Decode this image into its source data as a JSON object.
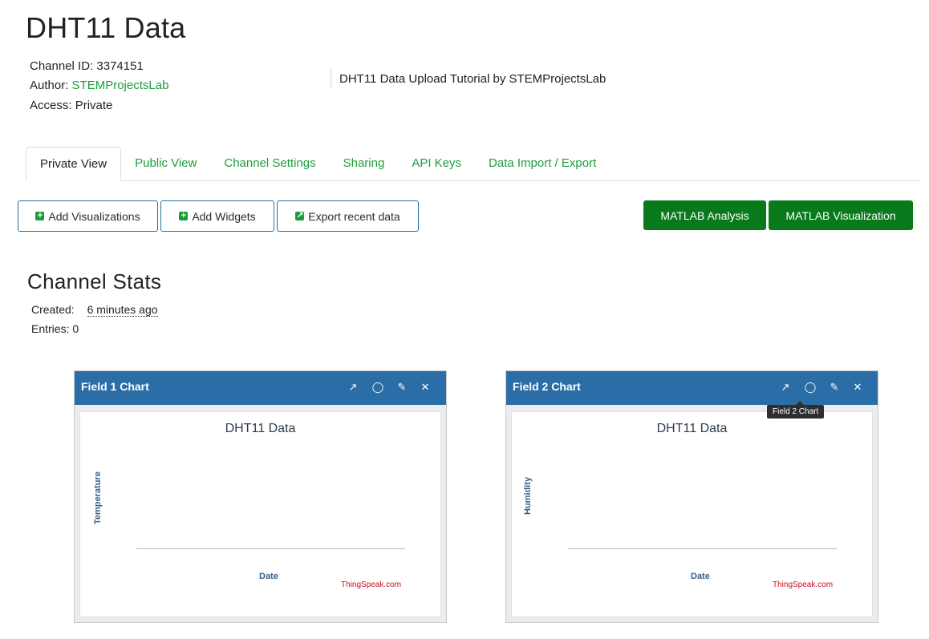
{
  "channel": {
    "title": "DHT11 Data",
    "id_label": "Channel ID:",
    "id_value": "3374151",
    "author_label": "Author:",
    "author_value": "STEMProjectsLab",
    "access_label": "Access:",
    "access_value": "Private",
    "description": "DHT11 Data Upload Tutorial by STEMProjectsLab"
  },
  "tabs": [
    {
      "label": "Private View",
      "active": true
    },
    {
      "label": "Public View"
    },
    {
      "label": "Channel Settings"
    },
    {
      "label": "Sharing"
    },
    {
      "label": "API Keys"
    },
    {
      "label": "Data Import / Export"
    }
  ],
  "toolbar": {
    "add_visualizations": "Add Visualizations",
    "add_widgets": "Add Widgets",
    "export_recent": "Export recent data",
    "matlab_analysis": "MATLAB Analysis",
    "matlab_visualization": "MATLAB Visualization"
  },
  "stats": {
    "heading": "Channel Stats",
    "created_label": "Created:",
    "created_value": "6 minutes ago",
    "entries_label": "Entries:",
    "entries_value": "0"
  },
  "charts": [
    {
      "header": "Field 1 Chart",
      "title": "DHT11 Data",
      "ylabel": "Temperature",
      "xlabel": "Date",
      "credit": "ThingSpeak.com"
    },
    {
      "header": "Field 2 Chart",
      "title": "DHT11 Data",
      "ylabel": "Humidity",
      "xlabel": "Date",
      "credit": "ThingSpeak.com"
    }
  ],
  "tooltip": "Field 2 Chart",
  "icons": {
    "open": "external-link-icon",
    "comment": "comment-icon",
    "edit": "pencil-icon",
    "close": "close-icon"
  },
  "colors": {
    "link_green": "#1a9e3a",
    "button_green": "#087a1c",
    "card_header_blue": "#2b6ea7",
    "credit_red": "#c1121f"
  }
}
